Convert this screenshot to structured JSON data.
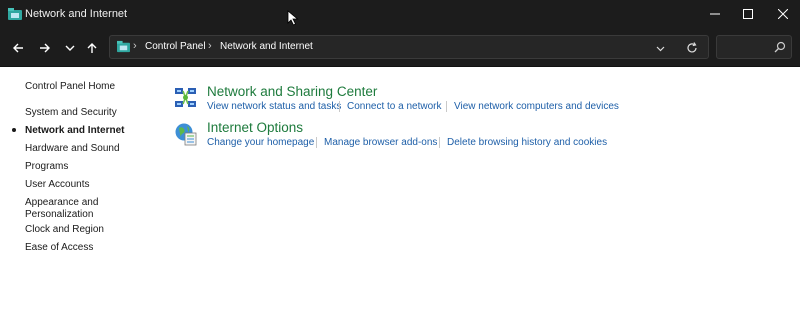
{
  "window": {
    "title": "Network and Internet",
    "controls": [
      "minimize",
      "maximize",
      "close"
    ]
  },
  "address_bar": {
    "breadcrumbs": [
      "Control Panel",
      "Network and Internet"
    ]
  },
  "search": {
    "placeholder": "",
    "value": ""
  },
  "sidebar": {
    "items": [
      {
        "label": "Control Panel Home",
        "active": false
      },
      {
        "label": "System and Security",
        "active": false
      },
      {
        "label": "Network and Internet",
        "active": true
      },
      {
        "label": "Hardware and Sound",
        "active": false
      },
      {
        "label": "Programs",
        "active": false
      },
      {
        "label": "User Accounts",
        "active": false
      },
      {
        "label": "Appearance and Personalization",
        "active": false
      },
      {
        "label": "Clock and Region",
        "active": false
      },
      {
        "label": "Ease of Access",
        "active": false
      }
    ]
  },
  "categories": [
    {
      "title": "Network and Sharing Center",
      "icon": "network-sharing-icon",
      "links": [
        "View network status and tasks",
        "Connect to a network",
        "View network computers and devices"
      ]
    },
    {
      "title": "Internet Options",
      "icon": "internet-options-icon",
      "links": [
        "Change your homepage",
        "Manage browser add-ons",
        "Delete browsing history and cookies"
      ]
    }
  ],
  "colors": {
    "titlebar": "#1c1c1c",
    "category_title": "#1e7b3d",
    "link": "#1e5fa8",
    "sidebar_text": "#1a1a1a"
  }
}
